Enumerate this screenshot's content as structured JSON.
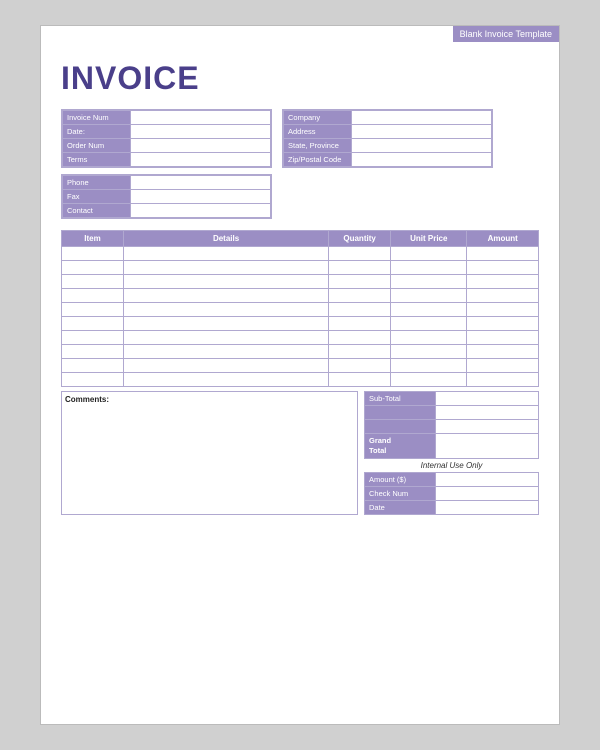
{
  "template": {
    "label": "Blank Invoice Template"
  },
  "header": {
    "title": "INVOICE"
  },
  "info_left": {
    "rows": [
      {
        "label": "Invoice Num",
        "value": ""
      },
      {
        "label": "Date:",
        "value": ""
      },
      {
        "label": "Order Num",
        "value": ""
      },
      {
        "label": "Terms",
        "value": ""
      }
    ]
  },
  "info_right": {
    "rows": [
      {
        "label": "Company",
        "value": ""
      },
      {
        "label": "Address",
        "value": ""
      },
      {
        "label": "State, Province",
        "value": ""
      },
      {
        "label": "Zip/Postal Code",
        "value": ""
      }
    ]
  },
  "contact_block": {
    "rows": [
      {
        "label": "Phone",
        "value": ""
      },
      {
        "label": "Fax",
        "value": ""
      },
      {
        "label": "Contact",
        "value": ""
      }
    ]
  },
  "table": {
    "headers": [
      "Item",
      "Details",
      "Quantity",
      "Unit Price",
      "Amount"
    ],
    "rows": 10
  },
  "comments": {
    "label": "Comments:"
  },
  "totals": {
    "subtotal_label": "Sub-Total",
    "subtotal_value": "",
    "row2_value": "",
    "row3_value": "",
    "grand_label": "Grand\nTotal",
    "grand_value": "",
    "internal_use": "Internal Use Only",
    "amount_label": "Amount ($)",
    "checknum_label": "Check Num",
    "date_label": "Date"
  }
}
